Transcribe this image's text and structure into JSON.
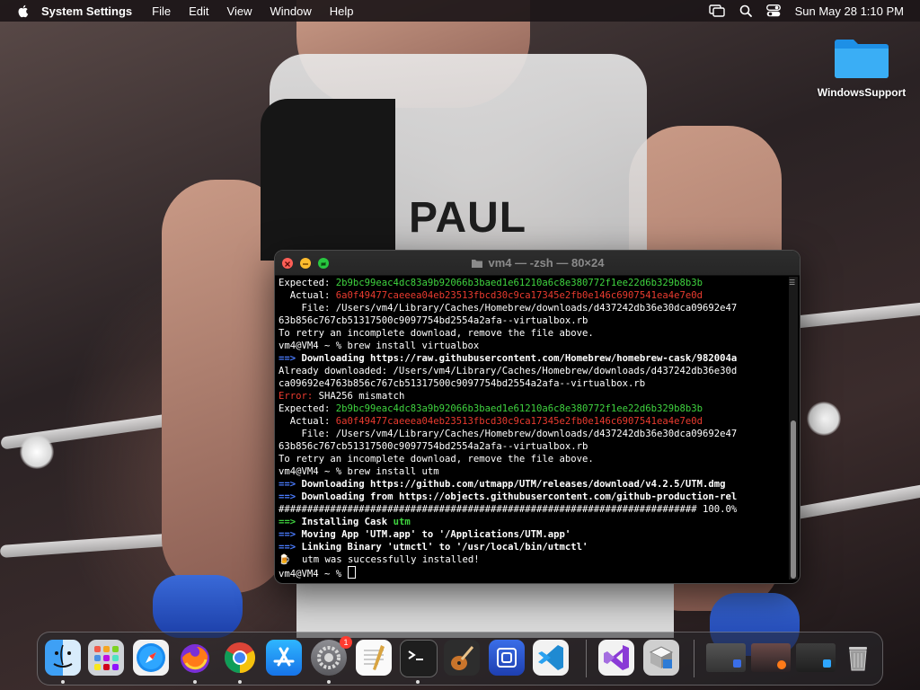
{
  "menubar": {
    "app_name": "System Settings",
    "menus": [
      "File",
      "Edit",
      "View",
      "Window",
      "Help"
    ],
    "clock": "Sun May 28  1:10 PM"
  },
  "desktop": {
    "folder_label": "WindowsSupport",
    "wallpaper_text": "PAUL"
  },
  "terminal": {
    "title": "vm4 — -zsh — 80×24",
    "lines": [
      [
        {
          "t": "Expected: "
        },
        {
          "t": "2b9bc99eac4dc83a9b92066b3baed1e61210a6c8e380772f1ee22d6b329b8b3b",
          "c": "green"
        }
      ],
      [
        {
          "t": "  Actual: "
        },
        {
          "t": "6a0f49477caeeea04eb23513fbcd30c9ca17345e2fb0e146c6907541ea4e7e0d",
          "c": "red"
        }
      ],
      [
        {
          "t": "    File: /Users/vm4/Library/Caches/Homebrew/downloads/d437242db36e30dca09692e47"
        }
      ],
      [
        {
          "t": "63b856c767cb51317500c9097754bd2554a2afa--virtualbox.rb"
        }
      ],
      [
        {
          "t": "To retry an incomplete download, remove the file above."
        }
      ],
      [
        {
          "t": "vm4@VM4 ~ % brew install virtualbox"
        }
      ],
      [
        {
          "t": "==> ",
          "c": "blue bold"
        },
        {
          "t": "Downloading https://raw.githubusercontent.com/Homebrew/homebrew-cask/982004a",
          "c": "bold"
        }
      ],
      [
        {
          "t": "Already downloaded: /Users/vm4/Library/Caches/Homebrew/downloads/d437242db36e30d"
        }
      ],
      [
        {
          "t": "ca09692e4763b856c767cb51317500c9097754bd2554a2afa--virtualbox.rb"
        }
      ],
      [
        {
          "t": "Error: ",
          "c": "red"
        },
        {
          "t": "SHA256 mismatch"
        }
      ],
      [
        {
          "t": "Expected: "
        },
        {
          "t": "2b9bc99eac4dc83a9b92066b3baed1e61210a6c8e380772f1ee22d6b329b8b3b",
          "c": "green"
        }
      ],
      [
        {
          "t": "  Actual: "
        },
        {
          "t": "6a0f49477caeeea04eb23513fbcd30c9ca17345e2fb0e146c6907541ea4e7e0d",
          "c": "red"
        }
      ],
      [
        {
          "t": "    File: /Users/vm4/Library/Caches/Homebrew/downloads/d437242db36e30dca09692e47"
        }
      ],
      [
        {
          "t": "63b856c767cb51317500c9097754bd2554a2afa--virtualbox.rb"
        }
      ],
      [
        {
          "t": "To retry an incomplete download, remove the file above."
        }
      ],
      [
        {
          "t": "vm4@VM4 ~ % brew install utm"
        }
      ],
      [
        {
          "t": "==> ",
          "c": "blue bold"
        },
        {
          "t": "Downloading https://github.com/utmapp/UTM/releases/download/v4.2.5/UTM.dmg",
          "c": "bold"
        }
      ],
      [
        {
          "t": "==> ",
          "c": "blue bold"
        },
        {
          "t": "Downloading from https://objects.githubusercontent.com/github-production-rel",
          "c": "bold"
        }
      ],
      [
        {
          "t": "######################################################################### 100.0%"
        }
      ],
      [
        {
          "t": "==> ",
          "c": "green bold"
        },
        {
          "t": "Installing Cask ",
          "c": "bold"
        },
        {
          "t": "utm",
          "c": "green bold"
        }
      ],
      [
        {
          "t": "==> ",
          "c": "blue bold"
        },
        {
          "t": "Moving App 'UTM.app' to '/Applications/UTM.app'",
          "c": "bold"
        }
      ],
      [
        {
          "t": "==> ",
          "c": "blue bold"
        },
        {
          "t": "Linking Binary 'utmctl' to '/usr/local/bin/utmctl'",
          "c": "bold"
        }
      ],
      [
        {
          "t": "🍺  utm was successfully installed!"
        }
      ],
      [
        {
          "t": "vm4@VM4 ~ % "
        },
        {
          "cursor": true
        }
      ]
    ]
  },
  "dock": {
    "apps": [
      {
        "name": "finder",
        "running": true
      },
      {
        "name": "launchpad",
        "running": false
      },
      {
        "name": "safari",
        "running": false
      },
      {
        "name": "firefox",
        "running": true
      },
      {
        "name": "chrome",
        "running": true
      },
      {
        "name": "app-store",
        "running": false
      },
      {
        "name": "system-settings",
        "running": true,
        "badge": "1"
      },
      {
        "name": "textedit",
        "running": false
      },
      {
        "name": "terminal",
        "running": true
      },
      {
        "name": "guitar",
        "running": false
      },
      {
        "name": "utm",
        "running": false
      },
      {
        "name": "vscode",
        "running": false
      },
      {
        "name": "visual-studio",
        "running": false
      },
      {
        "name": "boot-camp",
        "running": false
      }
    ]
  },
  "colors": {
    "accent_green": "#3fd33f",
    "error_red": "#ea3b2f",
    "arrow_blue": "#4a7cff"
  }
}
